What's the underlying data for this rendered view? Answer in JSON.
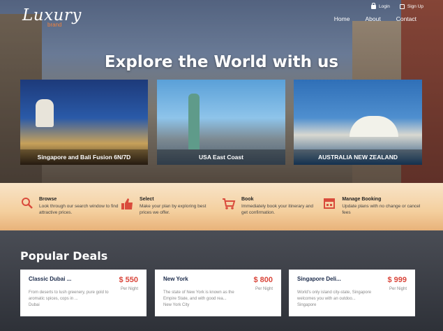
{
  "logo": {
    "script": "Luxury",
    "brand": "brand"
  },
  "auth": {
    "login": "Login",
    "signup": "Sign Up"
  },
  "nav": {
    "items": [
      "Home",
      "About",
      "Contact"
    ]
  },
  "hero": {
    "headline": "Explore the World with us"
  },
  "destinations": [
    {
      "caption": "Singapore and Bali Fusion 6N/7D"
    },
    {
      "caption": "USA East Coast"
    },
    {
      "caption": "AUSTRALIA NEW ZEALAND"
    }
  ],
  "features": [
    {
      "icon": "search-icon",
      "title": "Browse",
      "desc": "Look through our search window to find attractive prices."
    },
    {
      "icon": "thumbs-up-icon",
      "title": "Select",
      "desc": "Make your plan by exploring best prices we offer."
    },
    {
      "icon": "cart-icon",
      "title": "Book",
      "desc": "Immediately book your itinerary and get confirmation."
    },
    {
      "icon": "calendar-icon",
      "title": "Manage Booking",
      "desc": "Update plans with no change or cancel fees"
    }
  ],
  "deals": {
    "title": "Popular Deals",
    "cards": [
      {
        "name": "Classic Dubai ...",
        "price": "$ 550",
        "per": "Per Night",
        "desc": "From deserts to lush greenery, pure gold to aromatic spices, cops in ...",
        "location": "Dubai"
      },
      {
        "name": "New York",
        "price": "$ 800",
        "per": "Per Night",
        "desc": "The state of New York is known as the Empire State, and with good rea...",
        "location": "New York City"
      },
      {
        "name": "Singapore Deli...",
        "price": "$ 999",
        "per": "Per Night",
        "desc": "World's only island city-state, Singapore welcomes you with an outdoo...",
        "location": "Singapore"
      }
    ]
  },
  "colors": {
    "accent": "#f0823c",
    "price": "#d9453a",
    "icon": "#d94b3c"
  }
}
